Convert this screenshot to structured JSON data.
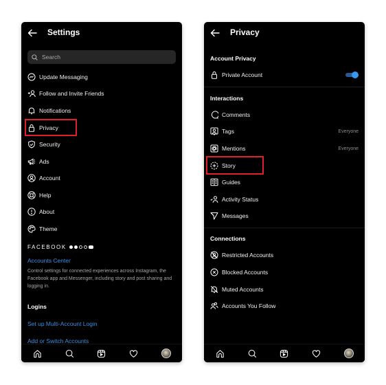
{
  "settings_screen": {
    "title": "Settings",
    "search": {
      "placeholder": "Search"
    },
    "menu_items": [
      {
        "label": "Update Messaging",
        "icon": "messenger-icon"
      },
      {
        "label": "Follow and Invite Friends",
        "icon": "add-person-icon"
      },
      {
        "label": "Notifications",
        "icon": "bell-icon"
      },
      {
        "label": "Privacy",
        "icon": "lock-icon",
        "highlighted": true
      },
      {
        "label": "Security",
        "icon": "shield-check-icon"
      },
      {
        "label": "Ads",
        "icon": "megaphone-icon"
      },
      {
        "label": "Account",
        "icon": "account-circle-icon"
      },
      {
        "label": "Help",
        "icon": "lifebuoy-icon"
      },
      {
        "label": "About",
        "icon": "info-icon"
      },
      {
        "label": "Theme",
        "icon": "palette-icon"
      }
    ],
    "facebook_brand": "FACEBOOK",
    "facebook_app_icons": [
      "facebook-icon",
      "messenger-icon",
      "instagram-icon",
      "whatsapp-icon",
      "oculus-icon"
    ],
    "accounts_center_link": "Accounts Center",
    "accounts_center_desc": "Control settings for connected experiences across Instagram, the Facebook app and Messenger, including story and post sharing and logging in.",
    "logins_section": "Logins",
    "multi_account_link": "Set up Multi-Account Login",
    "add_switch_link": "Add or Switch Accounts"
  },
  "privacy_screen": {
    "title": "Privacy",
    "account_privacy_section": "Account Privacy",
    "private_account": {
      "label": "Private Account",
      "enabled": true
    },
    "interactions_section": "Interactions",
    "interactions": [
      {
        "label": "Comments",
        "icon": "comment-icon",
        "value": ""
      },
      {
        "label": "Tags",
        "icon": "tag-person-icon",
        "value": "Everyone"
      },
      {
        "label": "Mentions",
        "icon": "at-sign-icon",
        "value": "Everyone"
      },
      {
        "label": "Story",
        "icon": "story-add-icon",
        "value": "",
        "highlighted": true
      },
      {
        "label": "Guides",
        "icon": "guides-icon",
        "value": ""
      },
      {
        "label": "Activity Status",
        "icon": "activity-status-icon",
        "value": ""
      },
      {
        "label": "Messages",
        "icon": "direct-message-icon",
        "value": ""
      }
    ],
    "connections_section": "Connections",
    "connections": [
      {
        "label": "Restricted Accounts",
        "icon": "restricted-icon"
      },
      {
        "label": "Blocked Accounts",
        "icon": "blocked-icon"
      },
      {
        "label": "Muted Accounts",
        "icon": "muted-bell-icon"
      },
      {
        "label": "Accounts You Follow",
        "icon": "people-icon"
      }
    ]
  },
  "bottom_nav": [
    "home-icon",
    "search-icon",
    "reels-icon",
    "heart-icon",
    "profile-avatar"
  ],
  "colors": {
    "background": "#000000",
    "link": "#3d8fe0",
    "highlight": "#e0202e",
    "toggle_on": "#3897f0",
    "search_bg": "#262626"
  }
}
